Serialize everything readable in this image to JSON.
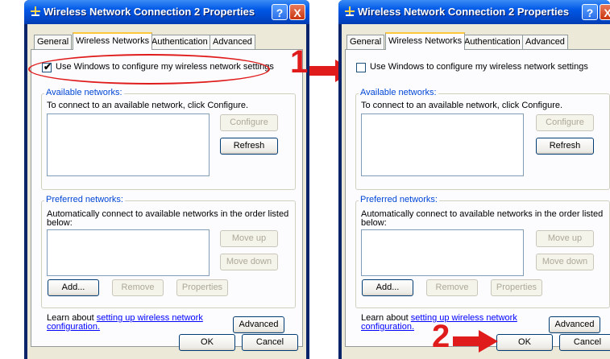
{
  "dialog_left": {
    "title": "Wireless Network Connection 2 Properties",
    "help_label": "?",
    "close_label": "X",
    "tabs": [
      {
        "label": "General"
      },
      {
        "label": "Wireless Networks"
      },
      {
        "label": "Authentication"
      },
      {
        "label": "Advanced"
      }
    ],
    "use_windows_label": "Use Windows to configure my wireless network settings",
    "use_windows_checked": true,
    "available_title": "Available networks:",
    "available_desc": "To connect to an available network, click Configure.",
    "configure_label": "Configure",
    "refresh_label": "Refresh",
    "preferred_title": "Preferred networks:",
    "preferred_desc_1": "Automatically connect to available networks in the order listed",
    "preferred_desc_2": "below:",
    "move_up_label": "Move up",
    "move_down_label": "Move down",
    "add_label": "Add...",
    "remove_label": "Remove",
    "properties_label": "Properties",
    "learn_text": "Learn about",
    "learn_link_1": "setting up wireless network",
    "learn_link_2": "configuration.",
    "advanced_label": "Advanced",
    "ok_label": "OK",
    "cancel_label": "Cancel"
  },
  "dialog_right": {
    "title": "Wireless Network Connection 2 Properties",
    "help_label": "?",
    "close_label": "X",
    "tabs": [
      {
        "label": "General"
      },
      {
        "label": "Wireless Networks"
      },
      {
        "label": "Authentication"
      },
      {
        "label": "Advanced"
      }
    ],
    "use_windows_label": "Use Windows to configure my wireless network settings",
    "use_windows_checked": false,
    "available_title": "Available networks:",
    "available_desc": "To connect to an available network, click Configure.",
    "configure_label": "Configure",
    "refresh_label": "Refresh",
    "preferred_title": "Preferred networks:",
    "preferred_desc_1": "Automatically connect to available networks in the order listed",
    "preferred_desc_2": "below:",
    "move_up_label": "Move up",
    "move_down_label": "Move down",
    "add_label": "Add...",
    "remove_label": "Remove",
    "properties_label": "Properties",
    "learn_text": "Learn about",
    "learn_link_1": "setting up wireless network",
    "learn_link_2": "configuration.",
    "advanced_label": "Advanced",
    "ok_label": "OK",
    "cancel_label": "Cancel"
  },
  "annotations": {
    "step_1": "1",
    "step_2": "2",
    "accent_color": "#e01b1b"
  }
}
